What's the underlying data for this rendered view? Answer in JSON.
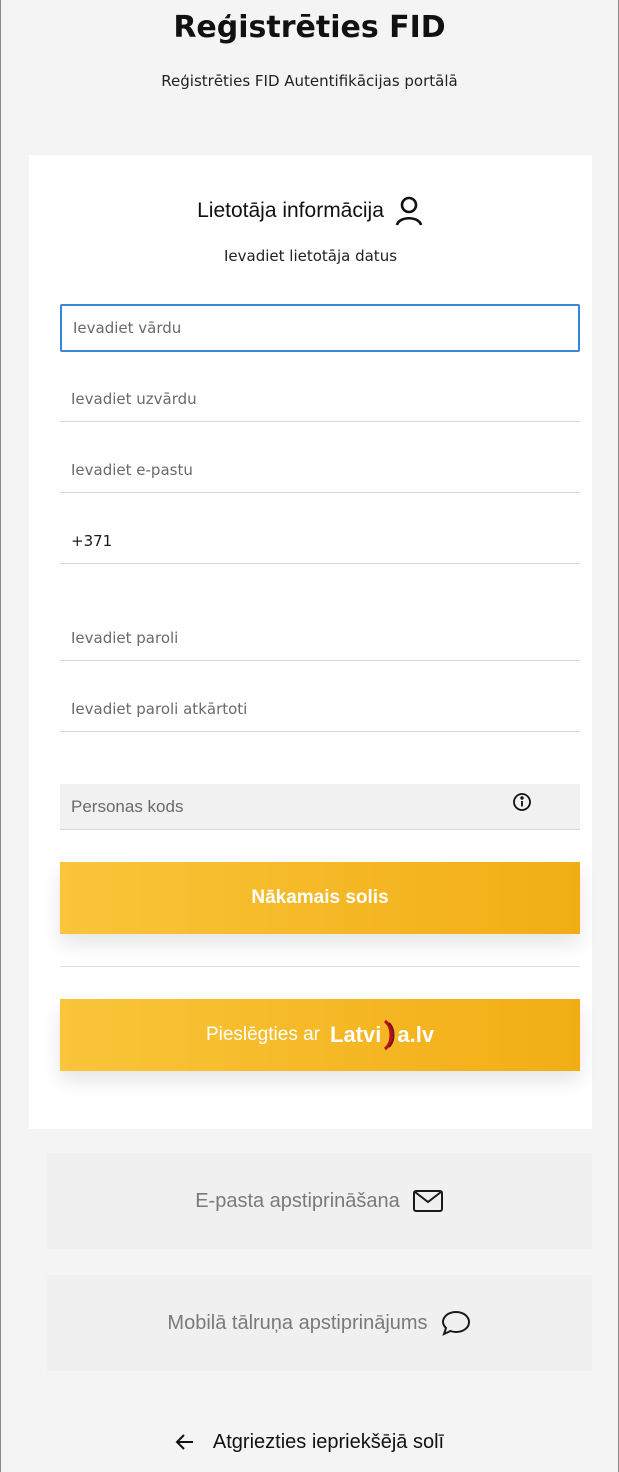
{
  "header": {
    "title": "Reģistrēties FID",
    "subtitle": "Reģistrēties FID Autentifikācijas portālā"
  },
  "user_section": {
    "title": "Lietotāja informācija",
    "hint": "Ievadiet lietotāja datus",
    "icon": "user-icon"
  },
  "form": {
    "first_name": {
      "placeholder": "Ievadiet vārdu",
      "value": ""
    },
    "last_name": {
      "placeholder": "Ievadiet uzvārdu",
      "value": ""
    },
    "email": {
      "placeholder": "Ievadiet e-pastu",
      "value": ""
    },
    "phone": {
      "value": "+371"
    },
    "password": {
      "placeholder": "Ievadiet paroli",
      "value": ""
    },
    "password_repeat": {
      "placeholder": "Ievadiet paroli atkārtoti",
      "value": ""
    },
    "personal_code": {
      "placeholder": "Personas kods",
      "value": ""
    }
  },
  "buttons": {
    "next_step": "Nākamais solis",
    "connect_with": "Pieslēgties ar",
    "latvija_brand_left": "Latvi",
    "latvija_brand_right": "a.lv"
  },
  "options": {
    "email_confirm": "E-pasta apstiprināšana",
    "mobile_confirm": "Mobilā tālruņa apstiprinājums"
  },
  "back": {
    "label": "Atgriezties iepriekšējā solī"
  },
  "colors": {
    "button_gradient_start": "#f9c53a",
    "button_gradient_end": "#f2ad14",
    "focus_border": "#3a86d6",
    "page_bg": "#f4f4f4"
  }
}
